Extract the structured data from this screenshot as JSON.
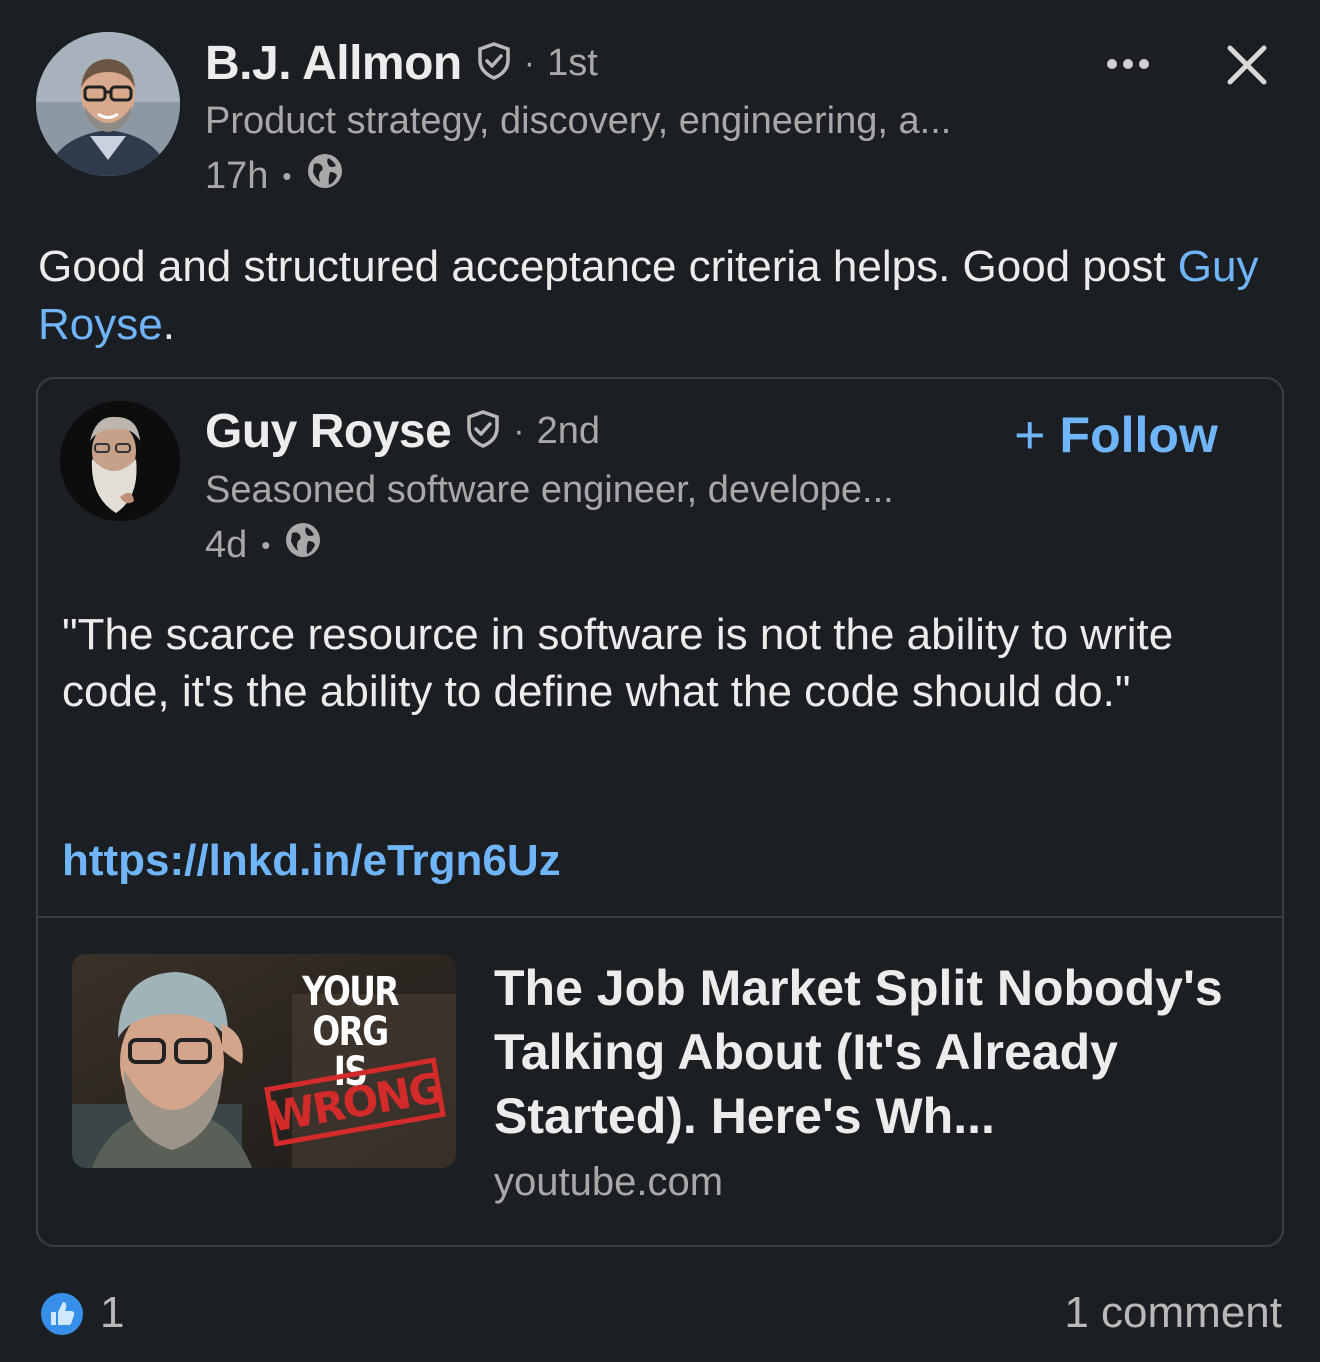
{
  "author": {
    "name": "B.J. Allmon",
    "degree": "1st",
    "headline": "Product strategy, discovery, engineering, a...",
    "time": "17h"
  },
  "post": {
    "text_before": "Good and structured acceptance criteria helps. Good post ",
    "mention": "Guy Royse",
    "text_after": "."
  },
  "shared": {
    "name": "Guy Royse",
    "degree": "2nd",
    "headline": "Seasoned software engineer, develope...",
    "time": "4d",
    "follow_label": "Follow",
    "quote": "\"The scarce resource in software is not the ability to write code, it's the ability to define what the code should do.\"",
    "link": "https://lnkd.in/eTrgn6Uz",
    "article": {
      "title": "The Job Market Split Nobody's Talking About (It's Already Started). Here's Wh...",
      "source": "youtube.com",
      "thumbnail_text_1": "YOUR ORG",
      "thumbnail_text_2": "IS",
      "thumbnail_text_3": "WRONG"
    }
  },
  "footer": {
    "reactions": "1",
    "comments": "1 comment"
  },
  "colors": {
    "background": "#1b1f23",
    "link": "#70b5f9",
    "secondary_text": "#a8a8a8"
  }
}
